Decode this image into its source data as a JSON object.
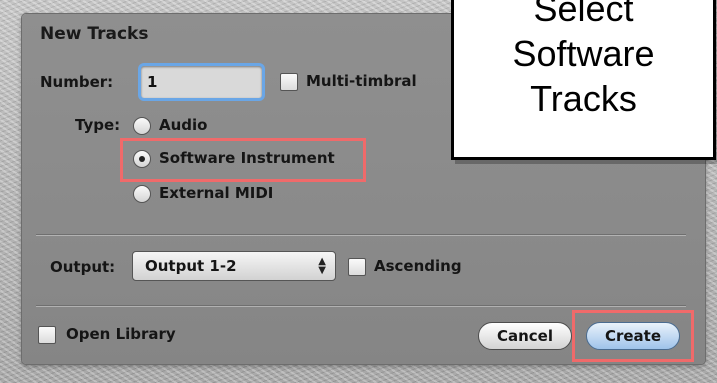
{
  "dialog": {
    "title": "New Tracks",
    "number_label": "Number:",
    "number_value": "1",
    "multitimbral_label": "Multi-timbral",
    "type_label": "Type:",
    "type_options": [
      {
        "label": "Audio",
        "selected": false
      },
      {
        "label": "Software Instrument",
        "selected": true
      },
      {
        "label": "External MIDI",
        "selected": false
      }
    ],
    "output_label": "Output:",
    "output_value": "Output 1-2",
    "ascending_label": "Ascending",
    "open_library_label": "Open Library",
    "cancel_label": "Cancel",
    "create_label": "Create"
  },
  "callout": {
    "line1": "Select",
    "line2": "Software",
    "line3": "Tracks"
  },
  "colors": {
    "highlight": "#f06a6a",
    "dialog_bg": "#8a8a8a",
    "focus_ring": "#6aa6e6"
  }
}
